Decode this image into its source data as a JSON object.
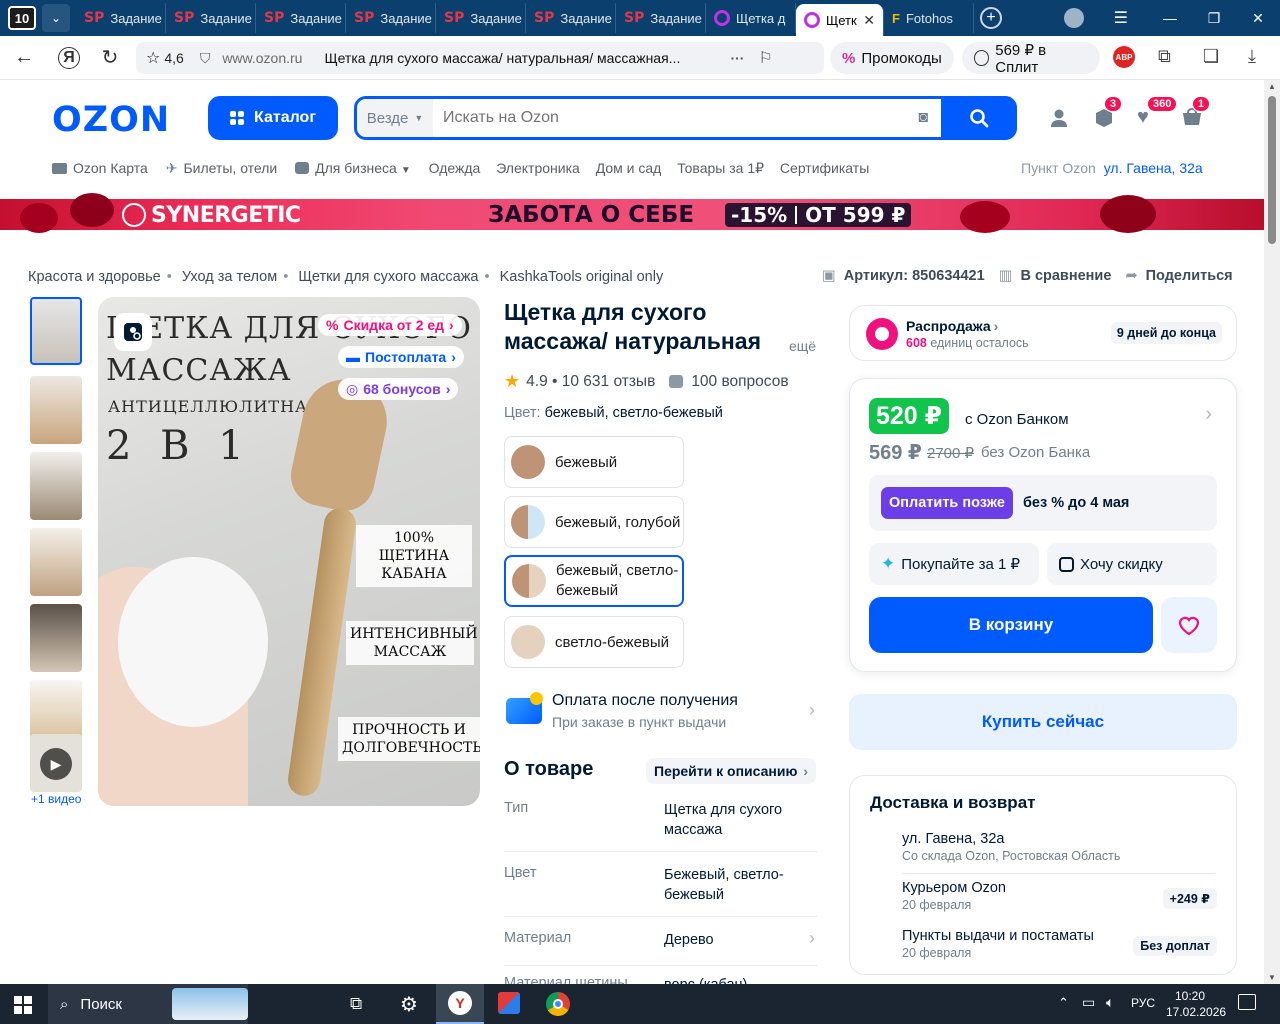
{
  "browser": {
    "tab_count": "10",
    "tabs": [
      {
        "label": "Задание",
        "icon": "SP"
      },
      {
        "label": "Задание",
        "icon": "SP"
      },
      {
        "label": "Задание",
        "icon": "SP"
      },
      {
        "label": "Задание",
        "icon": "SP"
      },
      {
        "label": "Задание",
        "icon": "SP"
      },
      {
        "label": "Задание",
        "icon": "SP"
      },
      {
        "label": "Задание",
        "icon": "SP"
      },
      {
        "label": "Щетка д",
        "icon": "ozon"
      },
      {
        "label": "Щетк",
        "icon": "ozon",
        "active": true
      },
      {
        "label": "Fotohos",
        "icon": "F"
      }
    ],
    "rating": "4,6",
    "domain": "www.ozon.ru",
    "page_title": "Щетка для сухого массажа/ натуральная/ массажная...",
    "promo_label": "Промокоды",
    "split_label": "569 ₽ в Сплит",
    "abp": "ABP"
  },
  "header": {
    "logo": "OZON",
    "catalog": "Каталог",
    "search_scope": "Везде",
    "search_placeholder": "Искать на Ozon",
    "badges": {
      "orders": "3",
      "favorites": "360",
      "cart": "1"
    }
  },
  "topnav": {
    "items": [
      "Ozon Карта",
      "Билеты, отели",
      "Для бизнеса",
      "Одежда",
      "Электроника",
      "Дом и сад",
      "Товары за 1₽",
      "Сертификаты"
    ],
    "pickup_label": "Пункт Ozon",
    "pickup_address": "ул. Гавена, 32а"
  },
  "banner": {
    "brand": "SYNERGETIC",
    "text": "ЗАБОТА О СЕБЕ",
    "discount": "-15%",
    "from": "ОТ 599 ₽"
  },
  "breadcrumbs": [
    "Красота и здоровье",
    "Уход за телом",
    "Щетки для сухого массажа",
    "KashkaTools original only"
  ],
  "actions": {
    "article": "Артикул: 850634421",
    "compare": "В сравнение",
    "share": "Поделиться"
  },
  "gallery": {
    "video_label": "+1 видео",
    "tags": {
      "discount": "Скидка от 2 ед",
      "postpay": "Постоплата",
      "bonus": "68 бонусов"
    },
    "image_text": {
      "line1": "ЩЕТКА ДЛЯ СУХОГО",
      "line2": "МАССАЖА",
      "line3": "АНТИЦЕЛЛЮЛИТНАЯ",
      "line4": "2 В 1",
      "feat1": "100% ЩЕТИНА КАБАНА",
      "feat2": "ИНТЕНСИВНЫЙ МАССАЖ",
      "feat3": "ПРОЧНОСТЬ И ДОЛГОВЕЧНОСТЬ"
    }
  },
  "product": {
    "title_line1": "Щетка для сухого",
    "title_line2": "массажа/ натуральная",
    "more": "ещё",
    "rating": "4.9 • 10 631 отзыв",
    "questions": "100 вопросов",
    "color_label": "Цвет:",
    "color_value": "бежевый, светло-бежевый",
    "colors": [
      {
        "label": "бежевый",
        "swatch": "#bf9476"
      },
      {
        "label": "бежевый, голубой",
        "swatch": "#bf9476"
      },
      {
        "label": "бежевый, светло-бежевый",
        "swatch": "#bf9476",
        "selected": true
      },
      {
        "label": "светло-бежевый",
        "swatch": "#e4d2bf"
      }
    ],
    "payment_title": "Оплата после получения",
    "payment_sub": "При заказе в пункт выдачи",
    "about_title": "О товаре",
    "about_link": "Перейти к описанию",
    "specs": [
      {
        "key": "Тип",
        "value": "Щетка для сухого массажа"
      },
      {
        "key": "Цвет",
        "value": "Бежевый, светло-бежевый"
      },
      {
        "key": "Материал",
        "value": "Дерево"
      },
      {
        "key": "Материал щетины",
        "value": "ворс (кабан)"
      }
    ]
  },
  "sale": {
    "title": "Распродажа",
    "count": "608",
    "count_suffix": " единиц осталось",
    "days": "9 дней до конца"
  },
  "price": {
    "card_price": "520 ₽",
    "card_label": "с Ozon Банком",
    "price": "569 ₽",
    "old_price": "2700 ₽",
    "no_bank": "без Ozon Банка",
    "pay_later": "Оплатить позже",
    "pay_later_note": "без % до 4 мая",
    "buy_for_1": "Покупайте за 1 ₽",
    "want_discount": "Хочу скидку",
    "add_to_cart": "В корзину",
    "buy_now": "Купить сейчас"
  },
  "delivery": {
    "title": "Доставка и возврат",
    "rows": [
      {
        "title": "ул. Гавена, 32а",
        "sub": "Со склада Ozon, Ростовская Область",
        "chip": ""
      },
      {
        "title": "Курьером Ozon",
        "sub": "20 февраля",
        "chip": "+249 ₽"
      },
      {
        "title": "Пункты выдачи и постаматы",
        "sub": "20 февраля",
        "chip": "Без доплат"
      }
    ]
  },
  "taskbar": {
    "search": "Поиск",
    "lang": "РУС",
    "time": "10:20",
    "date": "17.02.2026"
  },
  "colors": {
    "ozon_blue": "#005bff",
    "sale_green": "#10c44c",
    "badge_pink": "#f91155"
  }
}
